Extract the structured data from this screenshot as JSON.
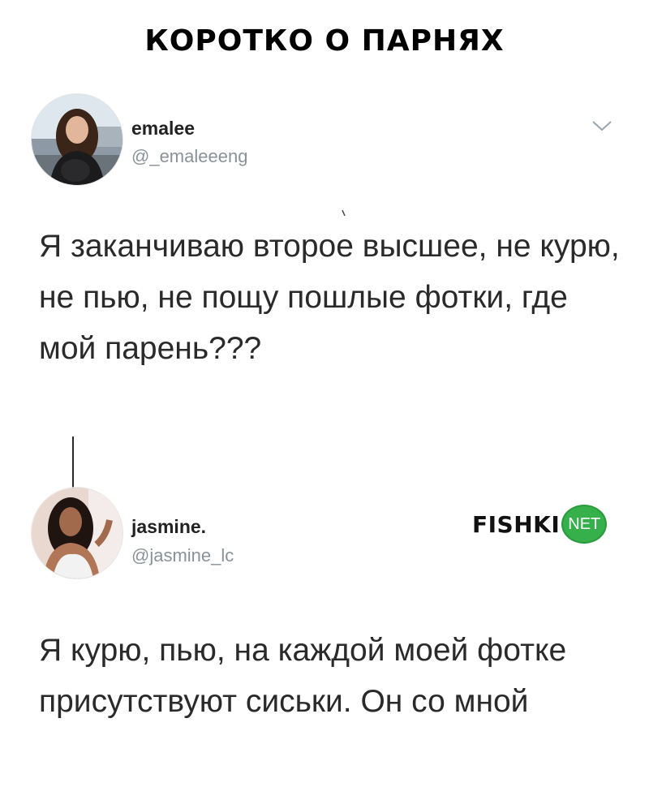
{
  "header": {
    "title": "КОРОТКО О ПАРНЯХ"
  },
  "tweets": [
    {
      "display_name": "emalee",
      "handle": "@_emaleeeng",
      "text": "Я заканчиваю второе высшее, не курю, не пью, не пощу пошлые фотки, где мой парень???",
      "avatar": "avatar-emalee",
      "menu_icon": "chevron-down-icon"
    },
    {
      "display_name": "jasmine.",
      "handle": "@jasmine_lc",
      "text": "Я курю, пью, на каждой моей фотке присутствуют сиськи. Он со мной",
      "avatar": "avatar-jasmine"
    }
  ],
  "watermark": {
    "text": "FISHKI",
    "badge": "NET",
    "badge_color": "#36b04a"
  }
}
